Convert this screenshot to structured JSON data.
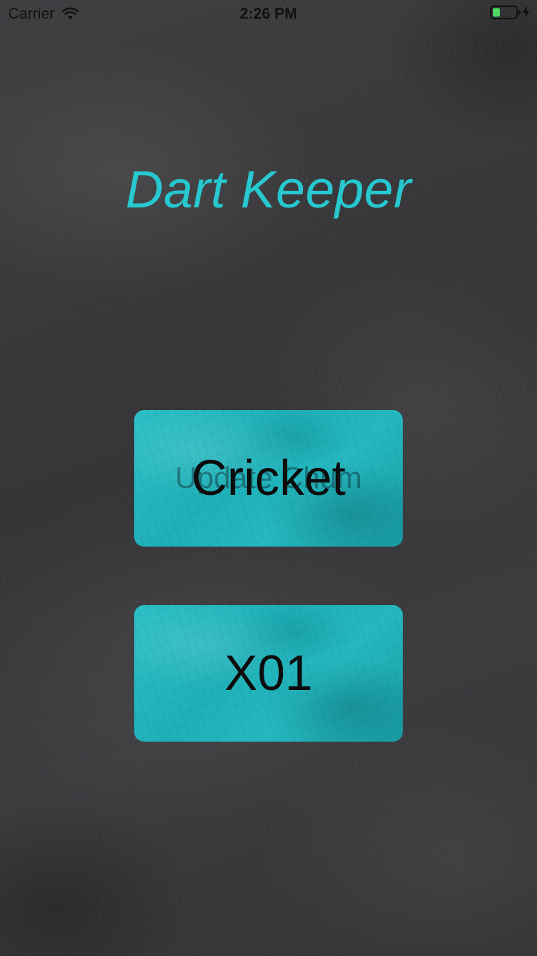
{
  "status_bar": {
    "carrier": "Carrier",
    "time": "2:26 PM",
    "battery_level": 0.3,
    "battery_color": "#4cd964"
  },
  "app": {
    "title": "Dart Keeper",
    "title_color": "#27c8d0"
  },
  "buttons": {
    "cricket": {
      "label": "Cricket",
      "ghost_label": "Update Chum"
    },
    "x01": {
      "label": "X01"
    }
  },
  "icons": {
    "wifi": "wifi-icon",
    "battery": "battery-icon",
    "charging": "charging-bolt-icon"
  }
}
